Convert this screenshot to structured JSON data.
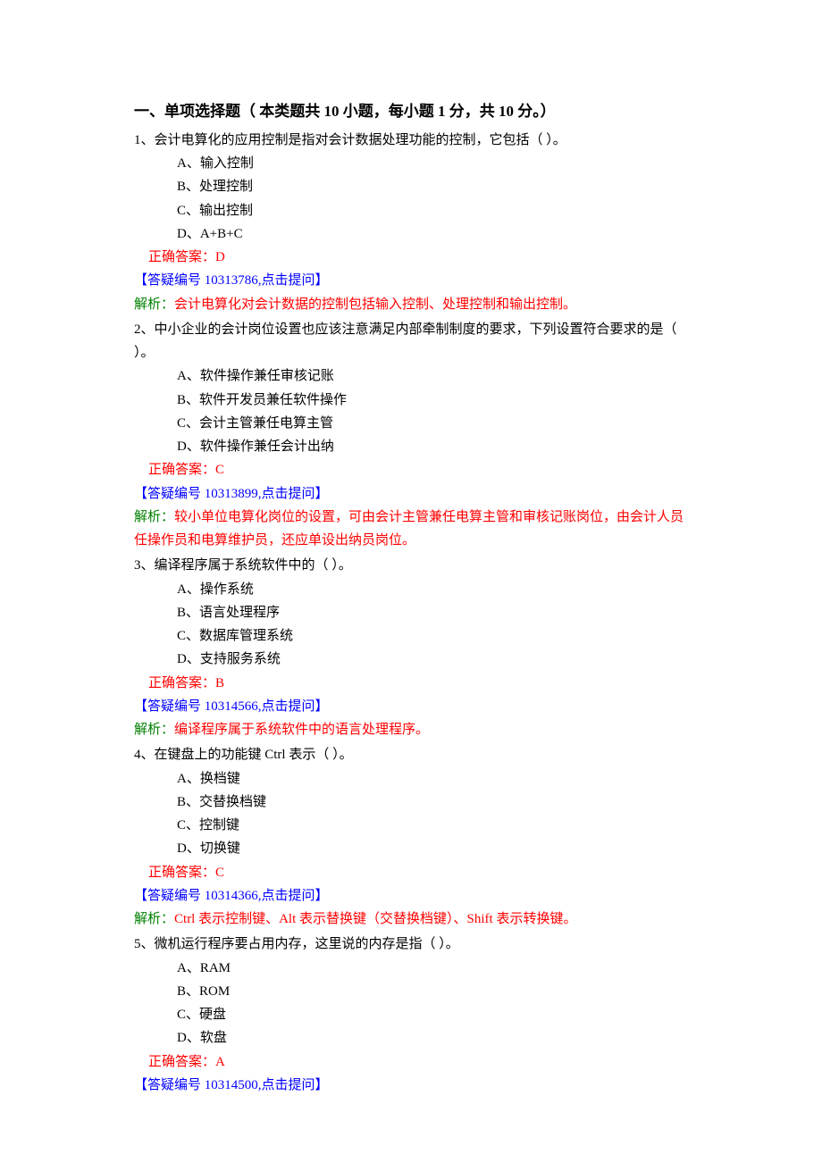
{
  "section_title": "一、单项选择题（ 本类题共 10 小题，每小题 1 分，共 10 分。）",
  "answer_prefix": "正确答案：",
  "qlink_prefix": "【答疑编号 ",
  "qlink_suffix": ",点击提问】",
  "explain_label": "解析：",
  "questions": [
    {
      "stem": "1、会计电算化的应用控制是指对会计数据处理功能的控制，它包括（ ）。",
      "options": [
        "A、输入控制",
        "B、处理控制",
        "C、输出控制",
        "D、A+B+C"
      ],
      "answer": "D",
      "qid": "10313786",
      "explain": "会计电算化对会计数据的控制包括输入控制、处理控制和输出控制。"
    },
    {
      "stem": "2、中小企业的会计岗位设置也应该注意满足内部牵制制度的要求，下列设置符合要求的是（ ）。",
      "options": [
        "A、软件操作兼任审核记账",
        "B、软件开发员兼任软件操作",
        "C、会计主管兼任电算主管",
        "D、软件操作兼任会计出纳"
      ],
      "answer": "C",
      "qid": "10313899",
      "explain": "较小单位电算化岗位的设置，可由会计主管兼任电算主管和审核记账岗位，由会计人员任操作员和电算维护员，还应单设出纳员岗位。"
    },
    {
      "stem": "3、编译程序属于系统软件中的（ ）。",
      "options": [
        "A、操作系统",
        "B、语言处理程序",
        "C、数据库管理系统",
        "D、支持服务系统"
      ],
      "answer": "B",
      "qid": "10314566",
      "explain": "编译程序属于系统软件中的语言处理程序。"
    },
    {
      "stem": "4、在键盘上的功能键 Ctrl 表示（ ）。",
      "options": [
        "A、换档键",
        "B、交替换档键",
        "C、控制键",
        "D、切换键"
      ],
      "answer": "C",
      "qid": "10314366",
      "explain": "Ctrl 表示控制键、Alt 表示替换键（交替换档键）、Shift 表示转换键。"
    },
    {
      "stem": "5、微机运行程序要占用内存，这里说的内存是指（ ）。",
      "options": [
        "A、RAM",
        "B、ROM",
        "C、硬盘",
        "D、软盘"
      ],
      "answer": "A",
      "qid": "10314500",
      "explain": null
    }
  ]
}
